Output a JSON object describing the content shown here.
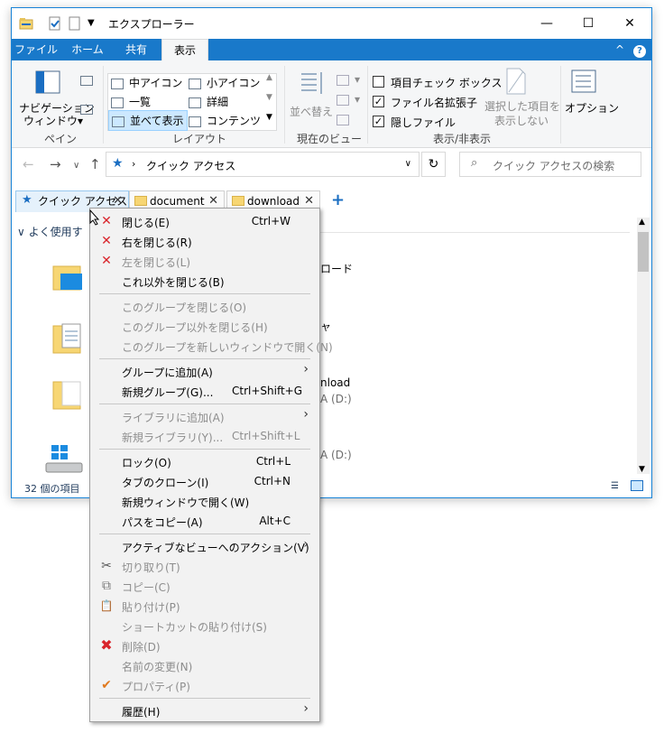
{
  "window": {
    "title": "エクスプローラー",
    "controls": {
      "minimize": "—",
      "maximize": "☐",
      "close": "✕"
    }
  },
  "ribbon_tabs": [
    "ファイル",
    "ホーム",
    "共有",
    "表示"
  ],
  "ribbon_help": {
    "collapse": "^",
    "help": "?"
  },
  "ribbon": {
    "pane": {
      "nav_label_1": "ナビゲーション",
      "nav_label_2": "ウィンドウ▾",
      "group": "ペイン"
    },
    "layout": {
      "items": [
        "中アイコン",
        "小アイコン",
        "一覧",
        "詳細",
        "並べて表示",
        "コンテンツ"
      ],
      "group": "レイアウト"
    },
    "current_view": {
      "sort_label": "並べ替え",
      "group": "現在のビュー"
    },
    "show_hide": {
      "item_checkboxes": "項目チェック ボックス",
      "file_ext": "ファイル名拡張子",
      "hidden_files": "隠しファイル",
      "hide_selected_1": "選択した項目を",
      "hide_selected_2": "表示しない",
      "group": "表示/非表示"
    },
    "options": {
      "label": "オプション"
    }
  },
  "address": {
    "path": "クイック アクセス",
    "refresh": "↻",
    "search_placeholder": "クイック アクセスの検索"
  },
  "tabs": [
    "クイック アクセス",
    "document",
    "download"
  ],
  "tab_add": "+",
  "content": {
    "section": "よく使用す",
    "items_visible": [
      "ロード",
      "ャ",
      "nload",
      "A (D:)",
      "A (D:)"
    ]
  },
  "status": {
    "count": "32 個の項目"
  },
  "context_menu": {
    "items": [
      {
        "label": "閉じる(E)",
        "shortcut": "Ctrl+W",
        "icon": "✕",
        "disabled": false
      },
      {
        "label": "右を閉じる(R)",
        "shortcut": "",
        "icon": "✕",
        "disabled": false
      },
      {
        "label": "左を閉じる(L)",
        "shortcut": "",
        "icon": "✕",
        "disabled": true
      },
      {
        "label": "これ以外を閉じる(B)",
        "shortcut": "",
        "icon": "",
        "disabled": false
      },
      {
        "label": "このグループを閉じる(O)",
        "shortcut": "",
        "icon": "",
        "disabled": true
      },
      {
        "label": "このグループ以外を閉じる(H)",
        "shortcut": "",
        "icon": "",
        "disabled": true
      },
      {
        "label": "このグループを新しいウィンドウで開く(N)",
        "shortcut": "",
        "icon": "",
        "disabled": true
      },
      {
        "label": "グループに追加(A)",
        "shortcut": "",
        "icon": "",
        "disabled": false,
        "submenu": true
      },
      {
        "label": "新規グループ(G)...",
        "shortcut": "Ctrl+Shift+G",
        "icon": "",
        "disabled": false
      },
      {
        "label": "ライブラリに追加(A)",
        "shortcut": "",
        "icon": "",
        "disabled": true,
        "submenu": true
      },
      {
        "label": "新規ライブラリ(Y)...",
        "shortcut": "Ctrl+Shift+L",
        "icon": "",
        "disabled": true
      },
      {
        "label": "ロック(O)",
        "shortcut": "Ctrl+L",
        "icon": "",
        "disabled": false
      },
      {
        "label": "タブのクローン(I)",
        "shortcut": "Ctrl+N",
        "icon": "",
        "disabled": false
      },
      {
        "label": "新規ウィンドウで開く(W)",
        "shortcut": "",
        "icon": "",
        "disabled": false
      },
      {
        "label": "パスをコピー(A)",
        "shortcut": "Alt+C",
        "icon": "",
        "disabled": false
      },
      {
        "label": "アクティブなビューへのアクション(V)",
        "shortcut": "",
        "icon": "",
        "disabled": false,
        "submenu": true
      },
      {
        "label": "切り取り(T)",
        "shortcut": "",
        "icon": "✂",
        "disabled": true
      },
      {
        "label": "コピー(C)",
        "shortcut": "",
        "icon": "⧉",
        "disabled": true
      },
      {
        "label": "貼り付け(P)",
        "shortcut": "",
        "icon": "📋",
        "disabled": true
      },
      {
        "label": "ショートカットの貼り付け(S)",
        "shortcut": "",
        "icon": "",
        "disabled": true
      },
      {
        "label": "削除(D)",
        "shortcut": "",
        "icon": "✖",
        "disabled": true
      },
      {
        "label": "名前の変更(N)",
        "shortcut": "",
        "icon": "",
        "disabled": true
      },
      {
        "label": "プロパティ(P)",
        "shortcut": "",
        "icon": "✔",
        "disabled": true
      },
      {
        "label": "履歴(H)",
        "shortcut": "",
        "icon": "",
        "disabled": false,
        "submenu": true
      }
    ]
  },
  "colors": {
    "accent": "#1979ca",
    "close_red": "#d9242b"
  }
}
